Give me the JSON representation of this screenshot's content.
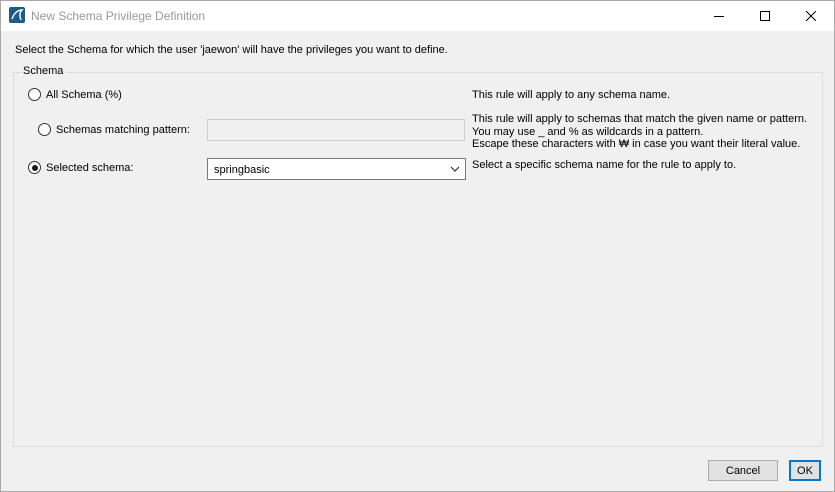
{
  "window": {
    "title": "New Schema Privilege Definition",
    "icon": "mysql-workbench-icon"
  },
  "intro_text": "Select the Schema for which the user 'jaewon' will have the privileges you want to define.",
  "schema_group": {
    "label": "Schema",
    "options": {
      "all": {
        "label": "All Schema (%)",
        "selected": false,
        "description": "This rule will apply to any schema name."
      },
      "pattern": {
        "label": "Schemas matching pattern:",
        "selected": false,
        "value": "",
        "description_line1": "This rule will apply to schemas that match the given name or pattern.",
        "description_line2": "You may use _ and % as wildcards in a pattern.",
        "description_line3": "Escape these characters with ₩ in case you want their literal value."
      },
      "selected": {
        "label": "Selected schema:",
        "selected": true,
        "value": "springbasic",
        "description": "Select a specific schema name for the rule to apply to."
      }
    }
  },
  "buttons": {
    "cancel": "Cancel",
    "ok": "OK"
  }
}
